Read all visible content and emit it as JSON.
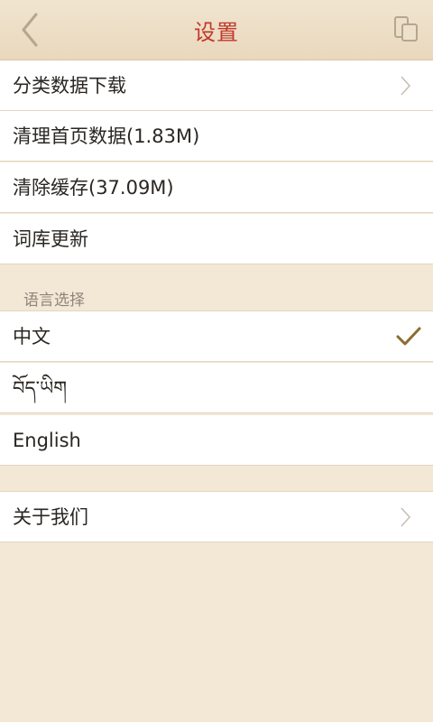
{
  "header": {
    "title": "设置",
    "back_icon": "chevron-left-icon",
    "copy_icon": "copy-icon"
  },
  "settings": {
    "items": [
      {
        "label": "分类数据下载"
      },
      {
        "label": "清理首页数据(1.83M)"
      },
      {
        "label": "清除缓存(37.09M)"
      },
      {
        "label": "词库更新"
      }
    ]
  },
  "language": {
    "section_label": "语言选择",
    "options": [
      {
        "label": "中文",
        "selected": true
      },
      {
        "label": "བོད་ཡིག",
        "selected": false
      },
      {
        "label": "English",
        "selected": false
      }
    ]
  },
  "about": {
    "label": "关于我们"
  },
  "colors": {
    "accent": "#c0392b",
    "check": "#8a6d2f",
    "background": "#f3e7d5"
  }
}
